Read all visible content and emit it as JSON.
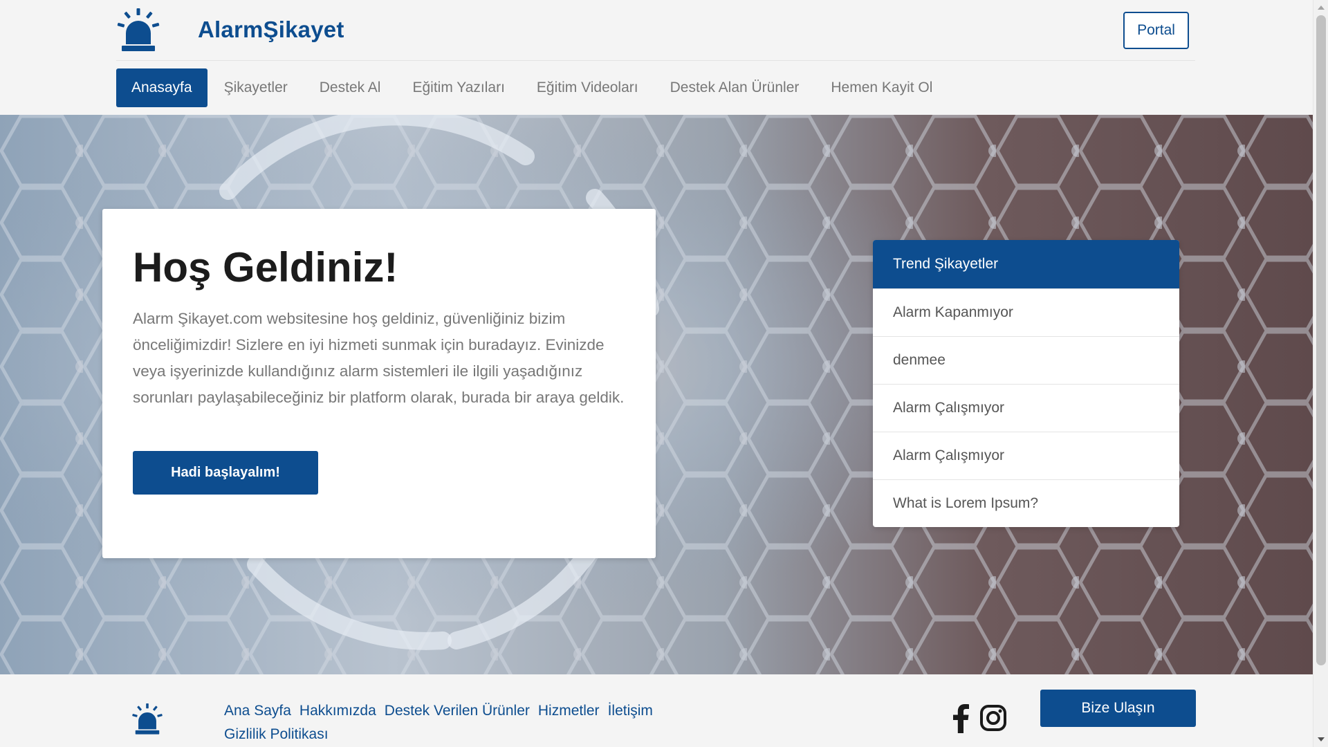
{
  "header": {
    "brand": "AlarmŞikayet",
    "portal_label": "Portal",
    "nav": [
      {
        "label": "Anasayfa",
        "active": true
      },
      {
        "label": "Şikayetler"
      },
      {
        "label": "Destek Al"
      },
      {
        "label": "Eğitim Yazıları"
      },
      {
        "label": "Eğitim Videoları"
      },
      {
        "label": "Destek Alan Ürünler"
      },
      {
        "label": "Hemen Kayit Ol"
      }
    ]
  },
  "hero": {
    "title": "Hoş Geldiniz!",
    "text": "Alarm Şikayet.com websitesine hoş geldiniz, güvenliğiniz bizim önceliğimizdir! Sizlere en iyi hizmeti sunmak için buradayız. Evinizde veya işyerinizde kullandığınız alarm sistemleri ile ilgili yaşadığınız sorunları paylaşabileceğiniz bir platform olarak, burada bir araya geldik.",
    "cta_label": "Hadi başlayalım!"
  },
  "trend": {
    "title": "Trend Şikayetler",
    "items": [
      "Alarm Kapanmıyor",
      "denmee",
      "Alarm Çalışmıyor",
      "Alarm Çalışmıyor",
      "What is Lorem Ipsum?"
    ]
  },
  "footer": {
    "links": [
      "Ana Sayfa",
      "Hakkımızda",
      "Destek Verilen Ürünler",
      "Hizmetler",
      "İletişim",
      "Gizlilik Politikası"
    ],
    "contact_label": "Bize Ulaşın",
    "social": [
      "facebook-icon",
      "instagram-icon"
    ]
  },
  "colors": {
    "primary": "#0d4d8f",
    "background": "#f4f4f4"
  }
}
